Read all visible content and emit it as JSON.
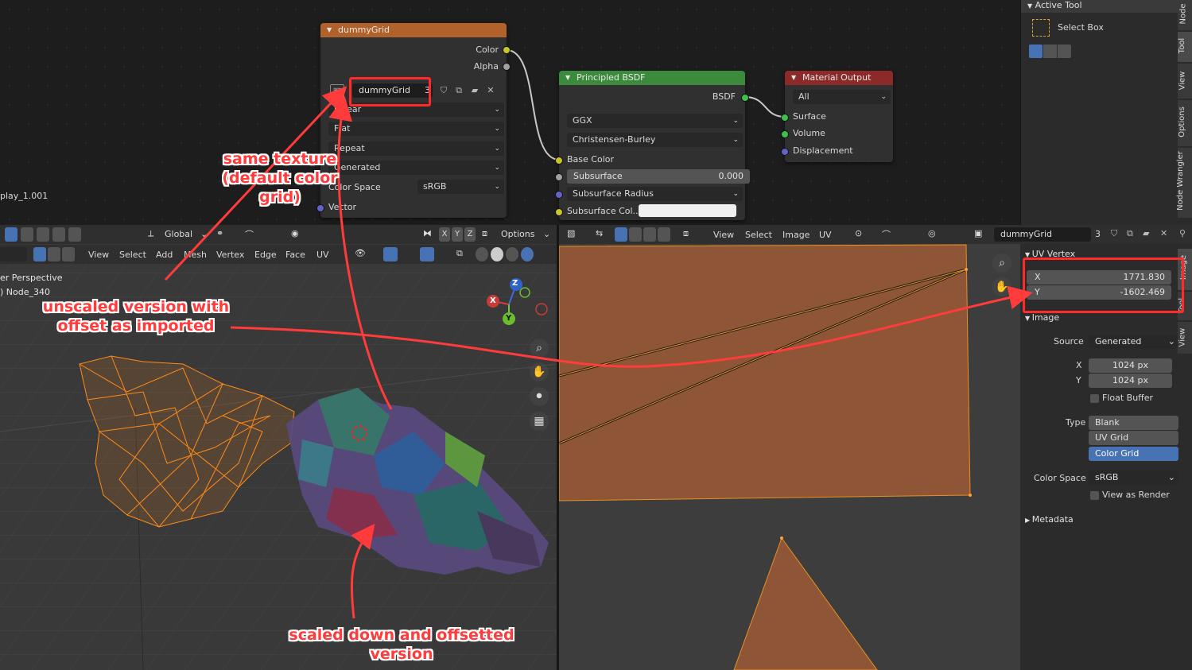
{
  "node_editor": {
    "side_text": "play_1.001",
    "image_node": {
      "title": "dummyGrid",
      "outputs": [
        "Color",
        "Alpha"
      ],
      "image_name": "dummyGrid",
      "user_count": "3",
      "interpolation": "Linear",
      "projection": "Flat",
      "extension": "Repeat",
      "source": "Generated",
      "color_space_label": "Color Space",
      "color_space": "sRGB",
      "input": "Vector"
    },
    "bsdf_node": {
      "title": "Principled BSDF",
      "output": "BSDF",
      "distribution": "GGX",
      "subsurface_method": "Christensen-Burley",
      "base_color": "Base Color",
      "subsurface_label": "Subsurface",
      "subsurface_value": "0.000",
      "subsurface_radius": "Subsurface Radius",
      "subsurface_color": "Subsurface Col..."
    },
    "output_node": {
      "title": "Material Output",
      "target": "All",
      "inputs": [
        "Surface",
        "Volume",
        "Displacement"
      ]
    }
  },
  "tool_panel": {
    "header": "Active Tool",
    "tool_name": "Select Box",
    "tabs": [
      "Node",
      "Tool",
      "View",
      "Options",
      "Node Wrangler"
    ]
  },
  "viewport": {
    "orientation": "Global",
    "options_label": "Options",
    "menus": [
      "View",
      "Select",
      "Add",
      "Mesh",
      "Vertex",
      "Edge",
      "Face",
      "UV"
    ],
    "view_label": "er Perspective",
    "object_label": ") Node_340",
    "gizmo": {
      "z": "Z",
      "x": "X",
      "y": "Y"
    }
  },
  "uv_editor": {
    "menus": [
      "View",
      "Select",
      "Image",
      "UV"
    ],
    "image_name": "dummyGrid",
    "user_count": "3"
  },
  "uv_sidebar": {
    "uv_vertex_header": "UV Vertex",
    "x_label": "X",
    "x_value": "1771.830",
    "y_label": "Y",
    "y_value": "-1602.469",
    "image_header": "Image",
    "source_label": "Source",
    "source_value": "Generated",
    "size_x_label": "X",
    "size_x": "1024 px",
    "size_y_label": "Y",
    "size_y": "1024 px",
    "float_buffer": "Float Buffer",
    "type_label": "Type",
    "type_options": [
      "Blank",
      "UV Grid",
      "Color Grid"
    ],
    "type_selected": "Color Grid",
    "color_space_label": "Color Space",
    "color_space": "sRGB",
    "view_as_render": "View as Render",
    "metadata_header": "Metadata",
    "tabs": [
      "Image",
      "Tool",
      "View"
    ]
  },
  "annotations": {
    "same_texture_1": "same texture",
    "same_texture_2": "(default color grid)",
    "unscaled_1": "unscaled version with",
    "unscaled_2": "offset as imported",
    "scaled_1": "scaled down and offsetted",
    "scaled_2": "version"
  },
  "colors": {
    "image_node_header": "#b0622a",
    "bsdf_header": "#3c8a3c",
    "output_header": "#8c2a2a",
    "selected": "#4772b3",
    "annotation": "#ff3b3b",
    "uv_face": "#8e5637"
  }
}
